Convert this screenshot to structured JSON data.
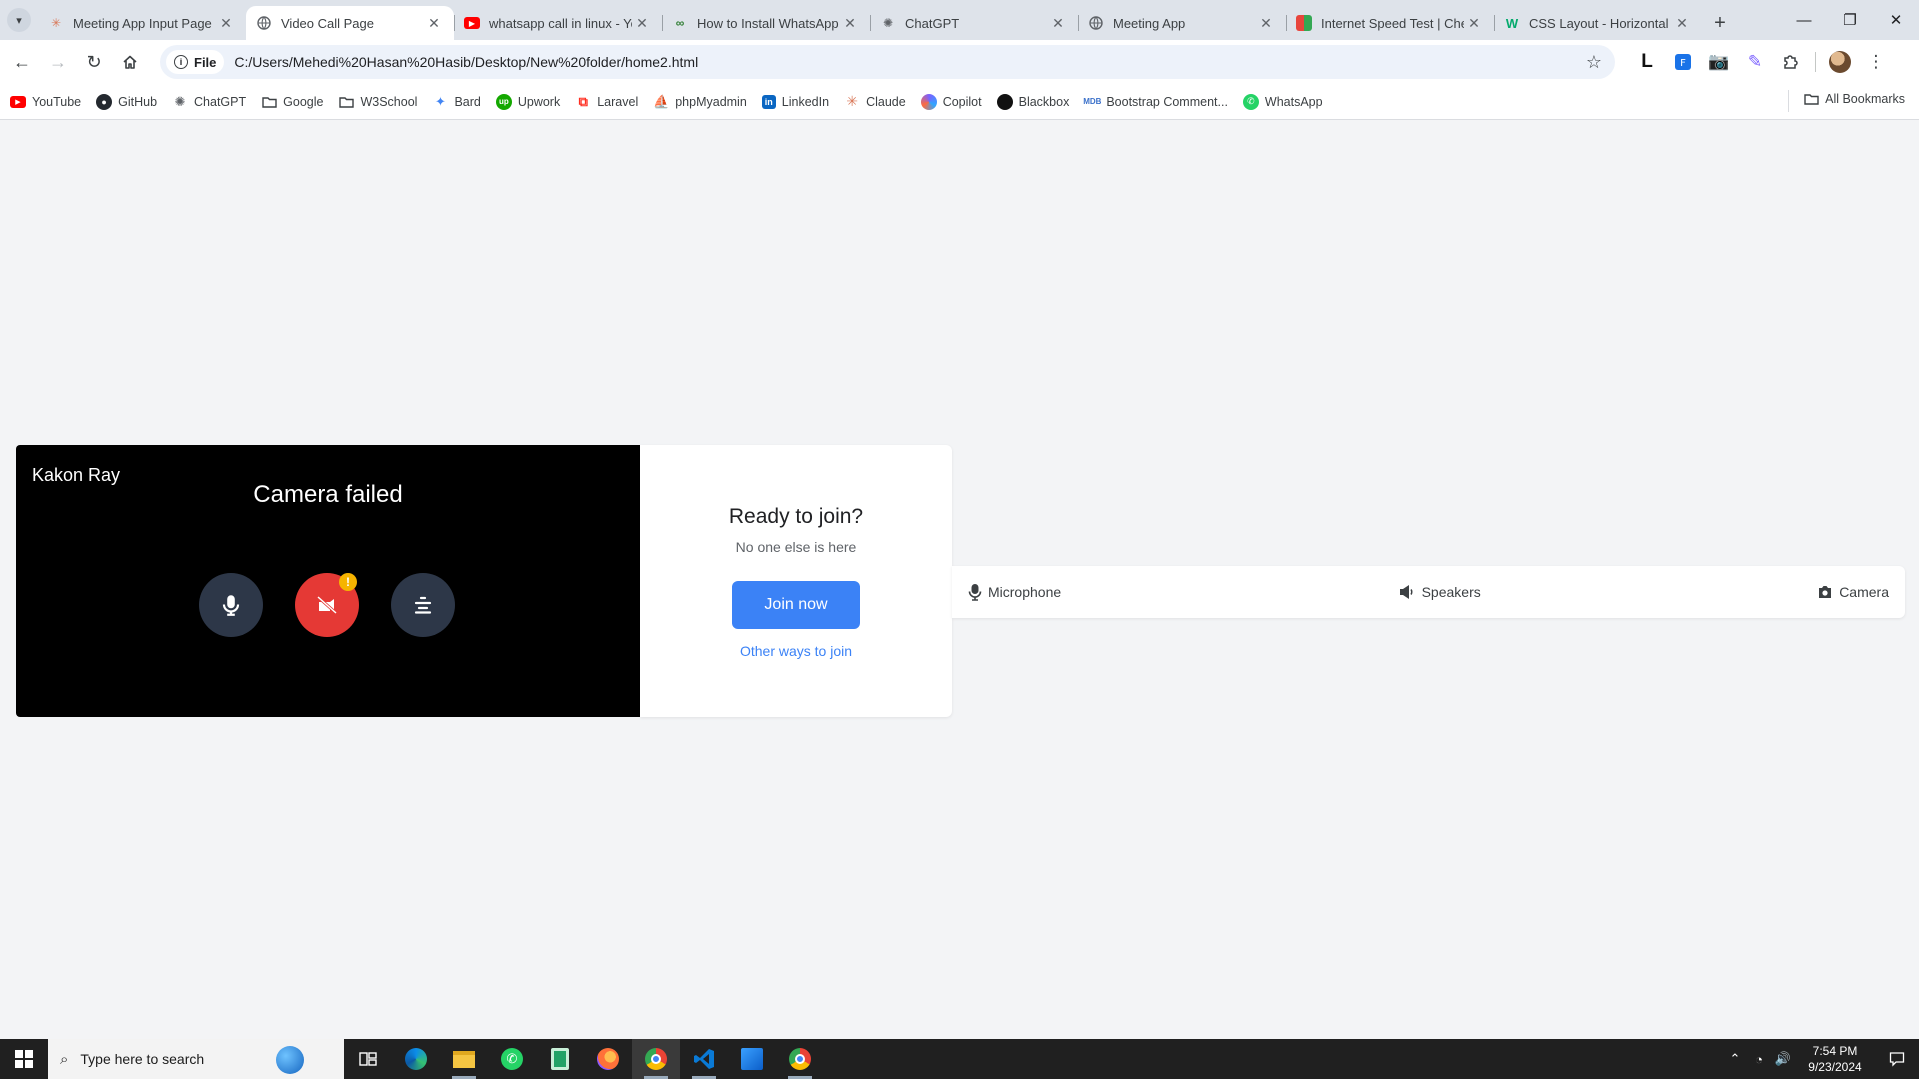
{
  "browser": {
    "tabs": [
      {
        "title": "Meeting App Input Page",
        "icon": "claude-icon",
        "color": "#d97757",
        "active": false
      },
      {
        "title": "Video Call Page",
        "icon": "globe-icon",
        "color": "#5f6368",
        "active": true
      },
      {
        "title": "whatsapp call in linux - Yo",
        "icon": "youtube-icon",
        "color": "#ff0000",
        "active": false
      },
      {
        "title": "How to Install WhatsApp",
        "icon": "site-icon",
        "color": "#2e7d32",
        "active": false
      },
      {
        "title": "ChatGPT",
        "icon": "chatgpt-icon",
        "color": "#5f6368",
        "active": false
      },
      {
        "title": "Meeting App",
        "icon": "globe-icon",
        "color": "#5f6368",
        "active": false
      },
      {
        "title": "Internet Speed Test | Che",
        "icon": "speedtest-icon",
        "color": "#e8453c",
        "active": false
      },
      {
        "title": "CSS Layout - Horizontal &",
        "icon": "w3schools-icon",
        "color": "#04aa6d",
        "active": false
      }
    ],
    "address": {
      "chip_label": "File",
      "url": "C:/Users/Mehedi%20Hasan%20Hasib/Desktop/New%20folder/home2.html"
    },
    "bookmarks": [
      {
        "label": "YouTube",
        "icon": "youtube-icon",
        "color": "#ff0000"
      },
      {
        "label": "GitHub",
        "icon": "github-icon",
        "color": "#24292f"
      },
      {
        "label": "ChatGPT",
        "icon": "chatgpt-icon",
        "color": "#5f6368"
      },
      {
        "label": "Google",
        "icon": "folder-icon",
        "color": "#5f6368"
      },
      {
        "label": "W3School",
        "icon": "folder-icon",
        "color": "#5f6368"
      },
      {
        "label": "Bard",
        "icon": "bard-icon",
        "color": "#4285f4"
      },
      {
        "label": "Upwork",
        "icon": "upwork-icon",
        "color": "#14a800"
      },
      {
        "label": "Laravel",
        "icon": "laravel-icon",
        "color": "#ff2d20"
      },
      {
        "label": "phpMyadmin",
        "icon": "phpmyadmin-icon",
        "color": "#f89c0e"
      },
      {
        "label": "LinkedIn",
        "icon": "linkedin-icon",
        "color": "#0a66c2"
      },
      {
        "label": "Claude",
        "icon": "claude-icon",
        "color": "#d97757"
      },
      {
        "label": "Copilot",
        "icon": "copilot-icon",
        "color": "#7b61ff"
      },
      {
        "label": "Blackbox",
        "icon": "blackbox-icon",
        "color": "#111111"
      },
      {
        "label": "Bootstrap Comment...",
        "icon": "mdb-icon",
        "color": "#3b71ca"
      },
      {
        "label": "WhatsApp",
        "icon": "whatsapp-icon",
        "color": "#25d366"
      }
    ],
    "all_bookmarks_label": "All Bookmarks"
  },
  "preview": {
    "user_name": "Kakon Ray",
    "camera_status": "Camera failed",
    "warning_mark": "!"
  },
  "join": {
    "heading": "Ready to join?",
    "subtext": "No one else is here",
    "join_button": "Join now",
    "other_link": "Other ways to join"
  },
  "devices": {
    "microphone": "Microphone",
    "speakers": "Speakers",
    "camera": "Camera"
  },
  "taskbar": {
    "search_placeholder": "Type here to search",
    "time": "7:54 PM",
    "date": "9/23/2024"
  },
  "colors": {
    "accent": "#3b82f6",
    "danger": "#e53935",
    "control_bg": "#2d3748",
    "page_bg": "#f3f4f6"
  }
}
